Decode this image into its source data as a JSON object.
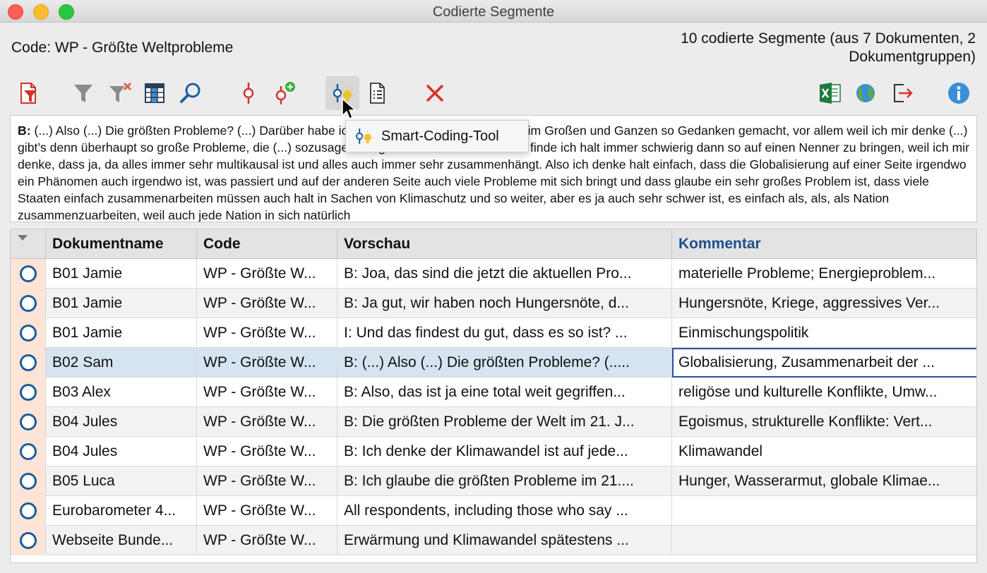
{
  "window": {
    "title": "Codierte Segmente"
  },
  "header": {
    "code_label": "Code: WP - Größte Weltprobleme",
    "segment_count_line1": "10 codierte Segmente (aus 7 Dokumenten, 2",
    "segment_count_line2": "Dokumentgruppen)"
  },
  "toolbar": {
    "icons": [
      "document-filter-icon",
      "filter-icon",
      "clear-filter-icon",
      "columns-icon",
      "search-icon",
      "code-icon",
      "add-code-icon",
      "smart-coding-tool-icon",
      "list-view-icon",
      "delete-icon",
      "excel-export-icon",
      "web-export-icon",
      "export-icon",
      "info-icon"
    ],
    "tooltip": "Smart-Coding-Tool"
  },
  "preview": {
    "speaker": "B:",
    "text": " (...) Also (...) Die größten Probleme? (...) Darüber habe ich mir eigentlich noch nie so also im Großen und Ganzen so Gedanken gemacht, vor allem weil ich mir denke (...) gibt’s denn überhaupt so große Probleme, die (...) sozusagen die ganze Welt umfassen. Das finde ich halt immer schwierig dann so auf einen Nenner zu bringen, weil ich mir denke, dass ja, da alles immer sehr multikausal ist und alles auch immer sehr zusammenhängt. Also ich denke halt einfach, dass die Globalisierung auf einer Seite irgendwo ein Phänomen auch irgendwo ist, was passiert und auf der anderen Seite auch viele Probleme mit sich bringt und dass glaube ein sehr großes Problem ist, dass viele Staaten einfach zusammenarbeiten müssen auch halt in Sachen von Klimaschutz und so weiter, aber es ja auch sehr schwer ist, es einfach als, als, als Nation zusammenzuarbeiten, weil auch jede Nation in sich natürlich"
  },
  "table": {
    "columns": [
      "Dokumentname",
      "Code",
      "Vorschau",
      "Kommentar"
    ],
    "accent_color": "#1e4f8c",
    "rows": [
      {
        "doc": "B01 Jamie",
        "code": "WP - Größte W...",
        "preview": "B: Joa, das sind die jetzt die aktuellen Pro...",
        "comment": "materielle Probleme; Energieproblem..."
      },
      {
        "doc": "B01 Jamie",
        "code": "WP - Größte W...",
        "preview": "B: Ja gut, wir haben noch Hungersnöte, d...",
        "comment": "Hungersnöte, Kriege, aggressives Ver..."
      },
      {
        "doc": "B01 Jamie",
        "code": "WP - Größte W...",
        "preview": "I: Und das findest du gut, dass es so ist?  ...",
        "comment": "Einmischungspolitik"
      },
      {
        "doc": "B02 Sam",
        "code": "WP - Größte W...",
        "preview": "B: (...) Also (...) Die größten Probleme? (.....",
        "comment": "Globalisierung, Zusammenarbeit der ..."
      },
      {
        "doc": "B03 Alex",
        "code": "WP - Größte W...",
        "preview": "B: Also, das ist ja eine total weit gegriffen...",
        "comment": "religöse und kulturelle Konflikte, Umw..."
      },
      {
        "doc": "B04 Jules",
        "code": "WP - Größte W...",
        "preview": "B: Die größten Probleme der Welt im 21. J...",
        "comment": "Egoismus, strukturelle Konflikte: Vert..."
      },
      {
        "doc": "B04 Jules",
        "code": "WP - Größte W...",
        "preview": "B: Ich denke der Klimawandel ist auf jede...",
        "comment": "Klimawandel"
      },
      {
        "doc": "B05 Luca",
        "code": "WP - Größte W...",
        "preview": "B: Ich glaube die größten Probleme im 21....",
        "comment": "Hunger, Wasserarmut, globale Klimae..."
      },
      {
        "doc": "Eurobarometer 4...",
        "code": "WP - Größte W...",
        "preview": "All respondents, including those who say ...",
        "comment": ""
      },
      {
        "doc": "Webseite Bunde...",
        "code": "WP - Größte W...",
        "preview": "Erwärmung und Klimawandel  spätestens ...",
        "comment": ""
      }
    ]
  }
}
